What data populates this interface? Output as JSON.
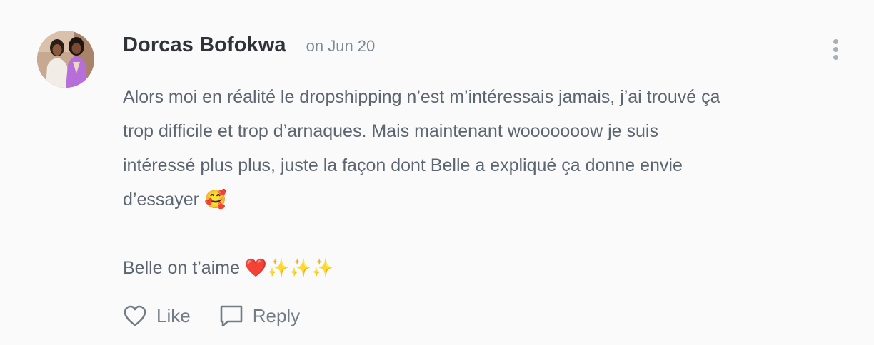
{
  "comment": {
    "author": "Dorcas Bofokwa",
    "date": "on Jun 20",
    "avatar_icon": "profile-photo",
    "more_icon": "vertical-ellipsis-icon",
    "body_paragraph_1": "Alors moi en réalité le dropshipping n’est m’intéressais jamais, j’ai trouvé ça\ntrop difficile et trop d’arnaques. Mais maintenant wooooooow je suis\nintéressé plus plus, juste la façon dont Belle a expliqué ça donne envie\nd’essayer 🥰",
    "body_paragraph_2": "Belle on t’aime ❤️✨✨✨",
    "actions": {
      "like_label": "Like",
      "like_icon": "heart-outline-icon",
      "reply_label": "Reply",
      "reply_icon": "speech-bubble-icon"
    }
  },
  "colors": {
    "background": "#fafafa",
    "author": "#2f3338",
    "meta": "#7d8893",
    "body": "#5d6670",
    "action": "#727c86"
  }
}
